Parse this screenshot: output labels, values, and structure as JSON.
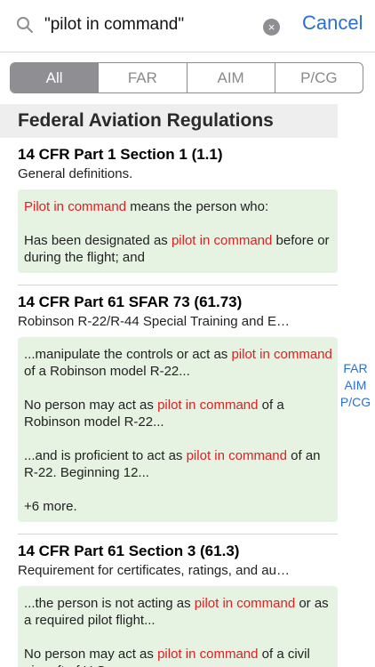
{
  "search": {
    "query": "\"pilot in command\"",
    "clear_icon": "×",
    "cancel_label": "Cancel"
  },
  "segments": [
    "All",
    "FAR",
    "AIM",
    "P/CG"
  ],
  "section_title": "Federal Aviation Regulations",
  "entries": [
    {
      "title": "14 CFR Part 1 Section 1  (1.1)",
      "subtitle": "General definitions.",
      "snippets": [
        {
          "a": "",
          "h": "Pilot in command",
          "b": " means the person who:"
        },
        {
          "a": "Has been designated as ",
          "h": "pilot in command",
          "b": " before or during the flight; and"
        }
      ]
    },
    {
      "title": "14 CFR Part 61 SFAR 73  (61.73)",
      "subtitle": "Robinson R-22/R-44 Special Training and E…",
      "snippets": [
        {
          "a": "...manipulate the controls or act as ",
          "h": "pilot in command",
          "b": " of a Robinson model R-22..."
        },
        {
          "a": "No person may act as ",
          "h": "pilot in command",
          "b": " of a Robinson model R-22..."
        },
        {
          "a": "...and is proficient to act as ",
          "h": "pilot in command",
          "b": " of an R-22. Beginning 12..."
        }
      ],
      "more": "+6 more."
    },
    {
      "title": "14 CFR Part 61 Section 3  (61.3)",
      "subtitle": "Requirement for certificates, ratings, and au…",
      "snippets": [
        {
          "a": "...the person is not acting as ",
          "h": "pilot in command",
          "b": " or as a required pilot flight..."
        },
        {
          "a": " No person may act as ",
          "h": "pilot in command",
          "b": " of a civil aircraft of U.S..."
        }
      ]
    }
  ],
  "index": [
    "FAR",
    "AIM",
    "P/CG"
  ]
}
